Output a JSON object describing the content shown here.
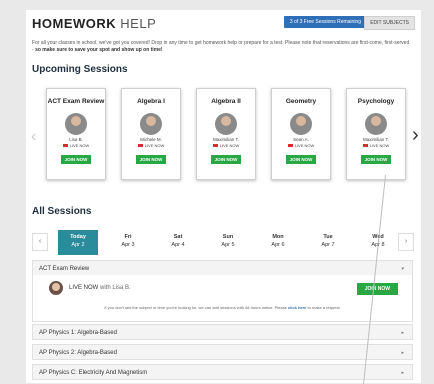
{
  "header": {
    "title_a": "HOMEWORK",
    "title_b": "HELP",
    "sessions_label": "3 of 3 Free Sessions Remaining",
    "edit_label": "EDIT SUBJECTS"
  },
  "intro": {
    "text": "For all your classes in school, we've got you covered! Drop in any time to get homework help or prepare for a test. Please note that reservations are first-come, first-served - ",
    "bold": "so make sure to save your spot and show up on time!"
  },
  "upcoming": {
    "heading": "Upcoming Sessions",
    "cards": [
      {
        "subject": "ACT Exam Review",
        "name": "Lisa B.",
        "live": "LIVE NOW",
        "join": "JOIN NOW"
      },
      {
        "subject": "Algebra I",
        "name": "Michele M.",
        "live": "LIVE NOW",
        "join": "JOIN NOW"
      },
      {
        "subject": "Algebra II",
        "name": "Maximilian T.",
        "live": "LIVE NOW",
        "join": "JOIN NOW"
      },
      {
        "subject": "Geometry",
        "name": "Sean A.",
        "live": "LIVE NOW",
        "join": "JOIN NOW"
      },
      {
        "subject": "Psychology",
        "name": "Maximilian T.",
        "live": "LIVE NOW",
        "join": "JOIN NOW"
      }
    ]
  },
  "all": {
    "heading": "All Sessions",
    "days": [
      {
        "dow": "Today",
        "date": "Apr 2"
      },
      {
        "dow": "Fri",
        "date": "Apr 3"
      },
      {
        "dow": "Sat",
        "date": "Apr 4"
      },
      {
        "dow": "Sun",
        "date": "Apr 5"
      },
      {
        "dow": "Mon",
        "date": "Apr 6"
      },
      {
        "dow": "Tue",
        "date": "Apr 7"
      },
      {
        "dow": "Wed",
        "date": "Apr 8"
      }
    ],
    "expanded": {
      "title": "ACT Exam Review",
      "live_prefix": "LIVE NOW",
      "live_with": " with Lisa B.",
      "join": "JOIN NOW",
      "note_a": "If you don't see the subject or time you're looking for, we can add sessions with 48 hours notice. Please ",
      "note_link": "click here",
      "note_b": " to make a request."
    },
    "rows": [
      "AP Physics 1: Algebra-Based",
      "AP Physics 2: Algebra-Based",
      "AP Physics C: Electricity And Magnetism"
    ]
  }
}
